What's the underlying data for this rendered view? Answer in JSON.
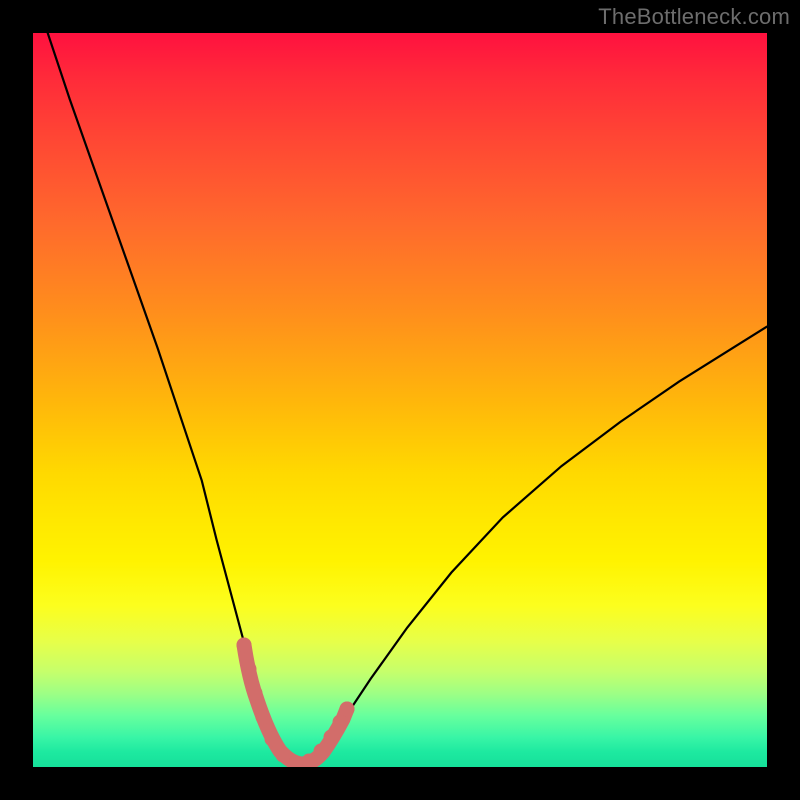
{
  "watermark": "TheBottleneck.com",
  "colors": {
    "background": "#000000",
    "gradient_top": "#ff113f",
    "gradient_upper_mid": "#ff8e1c",
    "gradient_mid": "#ffe900",
    "gradient_lower_mid": "#9dff85",
    "gradient_bottom": "#16e09a",
    "curve": "#000000",
    "highlight": "#d26d6a",
    "watermark_text": "#6d6d6d"
  },
  "chart_data": {
    "type": "line",
    "title": "",
    "xlabel": "",
    "ylabel": "",
    "xlim": [
      0,
      100
    ],
    "ylim": [
      0,
      100
    ],
    "grid": false,
    "legend_position": "none",
    "series": [
      {
        "name": "bottleneck-curve",
        "x": [
          2,
          5,
          8,
          11,
          14,
          17,
          20,
          23,
          25,
          27,
          29,
          30.5,
          32,
          33.5,
          35,
          37,
          39,
          42,
          46,
          51,
          57,
          64,
          72,
          80,
          88,
          96,
          100
        ],
        "y": [
          100,
          91,
          82.5,
          74,
          65.5,
          57,
          48,
          39,
          31,
          23.5,
          16,
          10,
          5,
          2,
          0.5,
          0.5,
          2,
          6,
          12,
          19,
          26.5,
          34,
          41,
          47,
          52.5,
          57.5,
          60
        ]
      }
    ],
    "highlight_region": {
      "description": "pink U-shaped marker at curve minimum",
      "x_range": [
        29,
        42
      ],
      "y_range": [
        0,
        16
      ]
    },
    "annotations": []
  }
}
